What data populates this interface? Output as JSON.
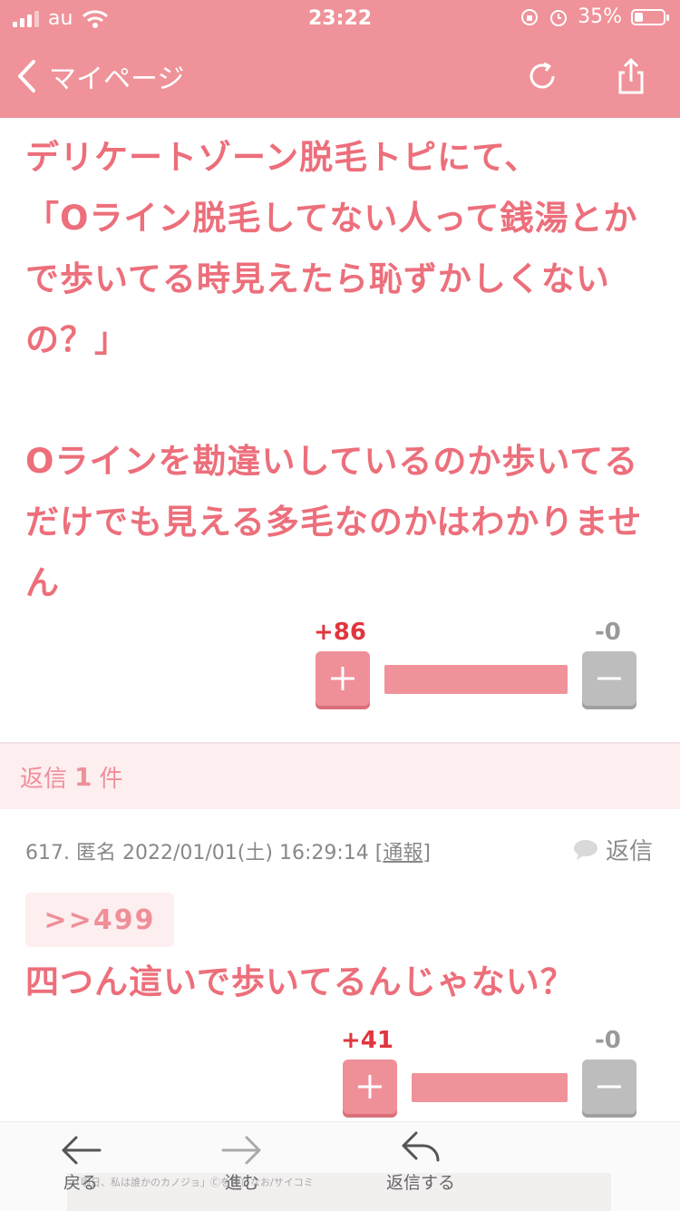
{
  "status_bar": {
    "carrier": "au",
    "time": "23:22",
    "battery": "35%",
    "battery_level": 0.35
  },
  "nav": {
    "back_label": "マイページ"
  },
  "post": {
    "text": "デリケートゾーン脱毛トピにて、\n「Oライン脱毛してない人って銭湯とかで歩いてる時見えたら恥ずかしくないの？」\n\nOラインを勘違いしているのか歩いてるだけでも見える多毛なのかはわかりません",
    "plus_count": "+86",
    "minus_count": "-0",
    "plus_ratio": 1.0
  },
  "replies": {
    "prefix": "返信",
    "count": "1",
    "suffix": "件"
  },
  "comment": {
    "number": "617.",
    "author": "匿名",
    "datetime": "2022/01/01(土) 16:29:14",
    "report_label": "通報",
    "reply_label": "返信",
    "anchor": ">>499",
    "text": "四つん這いで歩いてるんじゃない？",
    "plus_count": "+41",
    "minus_count": "-0",
    "plus_ratio": 1.0
  },
  "toolbar": {
    "back_label": "戻る",
    "forward_label": "進む",
    "reply_label": "返信する",
    "ad_caption": "「明日、私は誰かのカノジョ」Ⓒをのひなお/サイコミ"
  }
}
